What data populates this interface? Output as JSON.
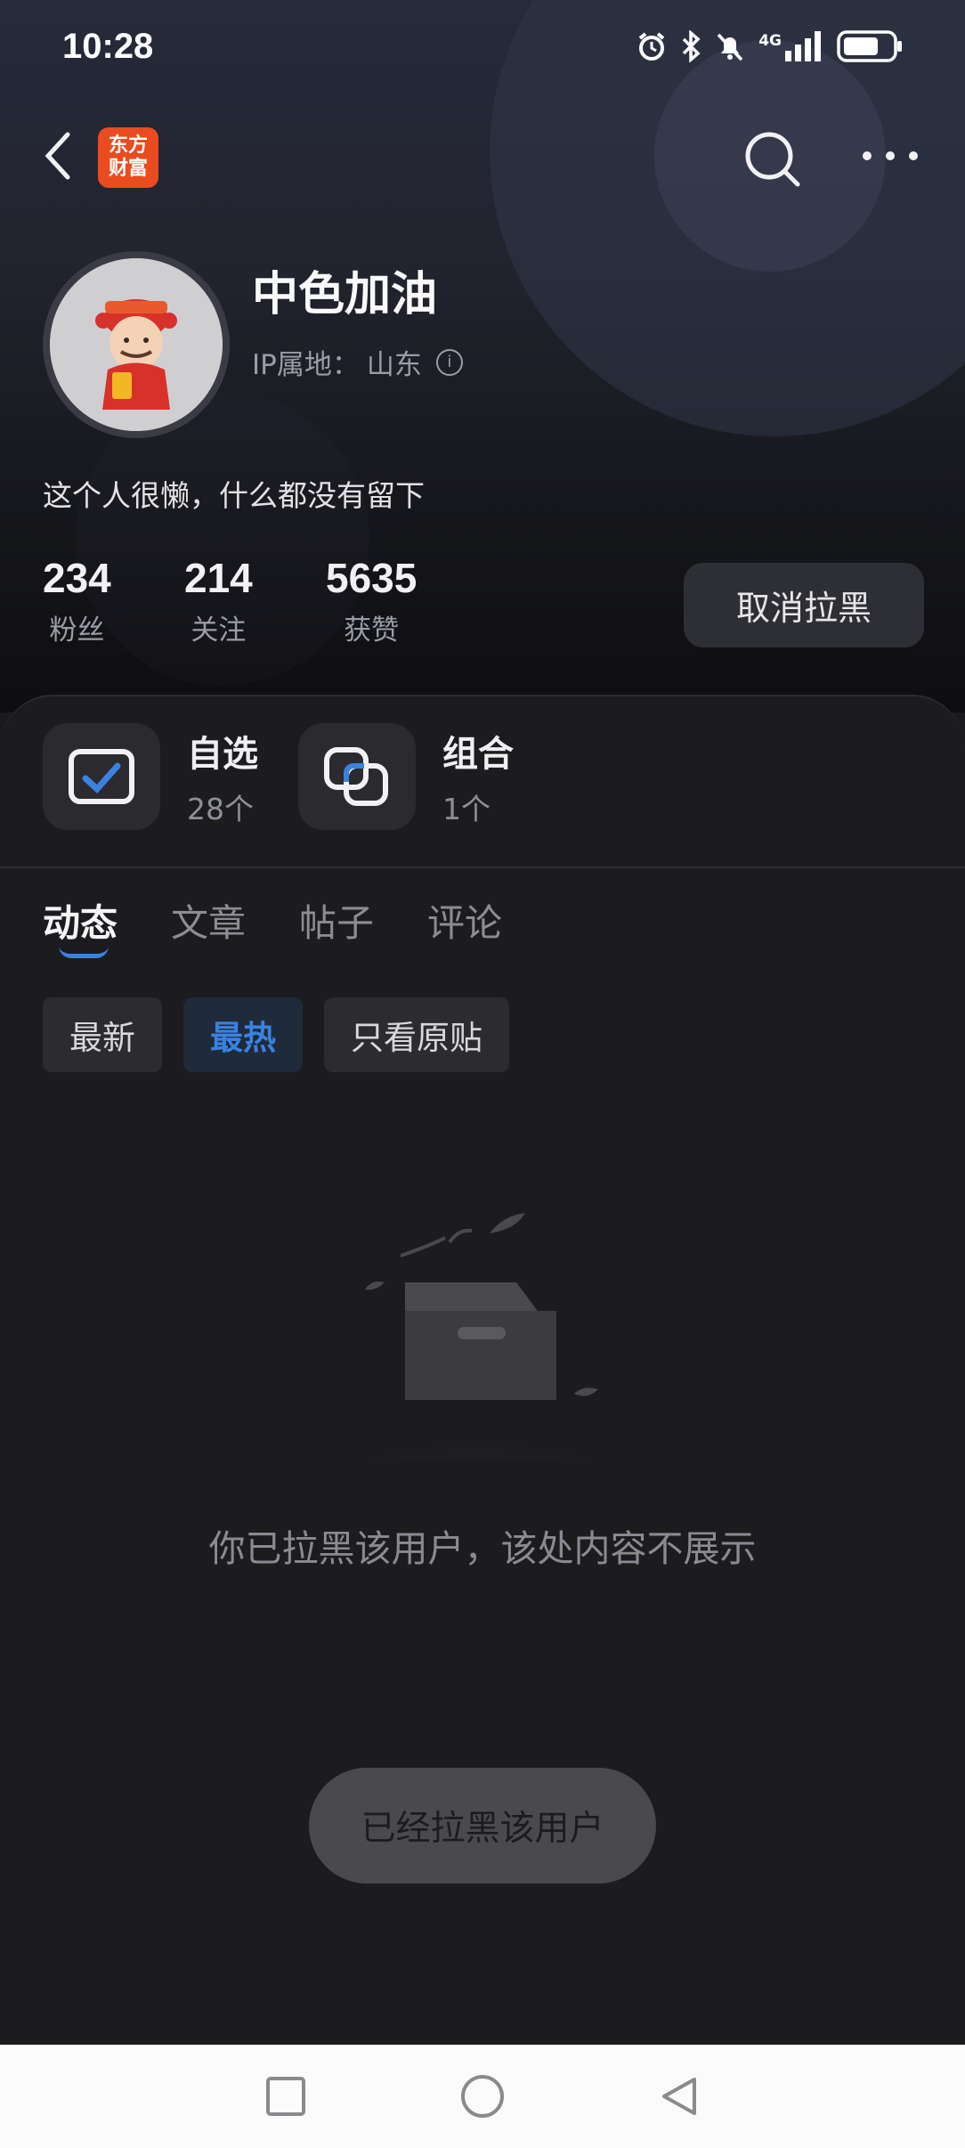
{
  "status_bar": {
    "time": "10:28",
    "network": "4G",
    "icons": [
      "alarm-icon",
      "bluetooth-icon",
      "mute-icon",
      "signal-icon",
      "battery-icon"
    ]
  },
  "nav": {
    "logo_line1": "东方",
    "logo_line2": "财富",
    "logo_color": "#ea4b1f",
    "icons": [
      "back-arrow-icon",
      "search-icon",
      "more-dots-icon"
    ]
  },
  "profile": {
    "name": "中色加油",
    "ip_label": "IP属地：",
    "ip_location": "山东",
    "bio": "这个人很懒，什么都没有留下",
    "stats": [
      {
        "value": "234",
        "label": "粉丝"
      },
      {
        "value": "214",
        "label": "关注"
      },
      {
        "value": "5635",
        "label": "获赞"
      }
    ],
    "unblock_button": "取消拉黑"
  },
  "quick_entries": [
    {
      "title": "自选",
      "count": "28个",
      "icon": "watchlist-check-icon"
    },
    {
      "title": "组合",
      "count": "1个",
      "icon": "portfolio-squares-icon"
    }
  ],
  "tabs": [
    {
      "label": "动态",
      "active": true
    },
    {
      "label": "文章",
      "active": false
    },
    {
      "label": "帖子",
      "active": false
    },
    {
      "label": "评论",
      "active": false
    }
  ],
  "filters": [
    {
      "label": "最新",
      "active": false
    },
    {
      "label": "最热",
      "active": true
    },
    {
      "label": "只看原贴",
      "active": false
    }
  ],
  "empty_state": {
    "icon": "empty-box-icon",
    "message": "你已拉黑该用户，该处内容不展示"
  },
  "toast": "已经拉黑该用户",
  "accent_color": "#3a82e0",
  "system_nav": [
    "recent-apps-icon",
    "home-icon",
    "back-icon"
  ]
}
